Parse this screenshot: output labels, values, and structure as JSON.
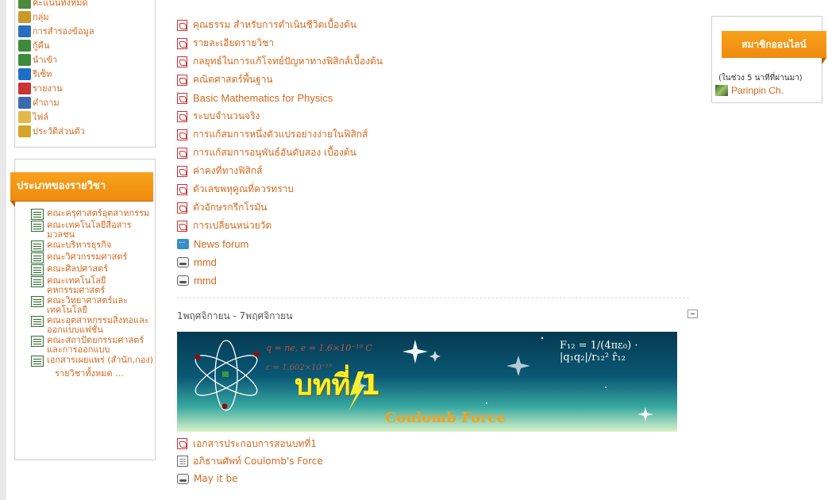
{
  "admin_menu": {
    "items": [
      {
        "label": "คะแนนทั้งหมด",
        "icon": "grades-icon"
      },
      {
        "label": "กลุ่ม",
        "icon": "groups-icon"
      },
      {
        "label": "การสำรองข้อมูล",
        "icon": "backup-icon"
      },
      {
        "label": "กู้คืน",
        "icon": "restore-icon"
      },
      {
        "label": "นำเข้า",
        "icon": "import-icon"
      },
      {
        "label": "รีเซ็ท",
        "icon": "reset-icon"
      },
      {
        "label": "รายงาน",
        "icon": "report-icon"
      },
      {
        "label": "คำถาม",
        "icon": "questions-icon"
      },
      {
        "label": "ไฟล์",
        "icon": "folder-icon"
      },
      {
        "label": "ประวัติส่วนตัว",
        "icon": "profile-icon"
      }
    ]
  },
  "categories": {
    "title": "ประเภทของรายวิชา",
    "items": [
      "คณะครุศาสตร์อุตสาหกรรม",
      "คณะเทคโนโลยีสื่อสารมวลชน",
      "คณะบริหารธุรกิจ",
      "คณะวิศวกรรมศาสตร์",
      "คณะศิลปศาสตร์",
      "คณะเทคโนโลยีคหกรรมศาสตร์",
      "คณะวิทยาศาสตร์และเทคโนโลยี",
      "คณะอุตสาหกรรมสิ่งทอและออกแบบแฟชั่น",
      "คณะสถาปัตยกรรมศาสตร์และการออกแบบ",
      "เอกสารเผยแพร่ (สำนัก,กอง)"
    ],
    "all_courses": "รายวิชาทั้งหมด ..."
  },
  "resources": [
    {
      "label": "คุณธรรม สำหรับการดำเนินชีวิตเบื้องต้น",
      "type": "pdf"
    },
    {
      "label": "รายละเอียดรายวิชา",
      "type": "pdf"
    },
    {
      "label": "กลยุทธ์ในการแก้โจทย์ปัญหาทางฟิสิกส์เบื้องต้น",
      "type": "pdf"
    },
    {
      "label": "คณิตศาสตร์พื้นฐาน",
      "type": "pdf"
    },
    {
      "label": "Basic Mathematics for Physics",
      "type": "pdf"
    },
    {
      "label": "ระบบจำนวนจริง",
      "type": "pdf"
    },
    {
      "label": "การแก้สมการหนึ่งตัวแปรอย่างง่ายในฟิสิกส์",
      "type": "pdf"
    },
    {
      "label": "การแก้สมการอนุพันธ์อันดับสอง เบื้องต้น",
      "type": "pdf"
    },
    {
      "label": "ค่าคงที่ทางฟิสิกส์",
      "type": "pdf"
    },
    {
      "label": "ตัวเลขพหุคูณที่ควรทราบ",
      "type": "pdf"
    },
    {
      "label": "ตัวอักษรกรีกโรมัน",
      "type": "pdf"
    },
    {
      "label": "การเปลี่ยนหน่วยวัด",
      "type": "pdf"
    },
    {
      "label": "News forum",
      "type": "forum"
    },
    {
      "label": "mmd",
      "type": "resource"
    },
    {
      "label": "mmd",
      "type": "resource"
    }
  ],
  "week": {
    "title": "1พฤศจิกายน - 7พฤศจิกายน",
    "banner": {
      "caption": "Coulomb Force",
      "thai_text": "บทที่ 1",
      "formula_left": "q = ne,   e = 1.6×10⁻¹⁹ C",
      "formula_left2": "ε = 1.602×10⁻¹⁹",
      "formula_right": "F₁₂ = 1/(4πε₀) · |q₁q₂|/r₁₂² r̂₁₂"
    },
    "items": [
      {
        "label": "เอกสารประกอบการสอนบทที่1",
        "type": "pdf"
      },
      {
        "label": "อภิธานศัพท์ Coulomb's Force",
        "type": "glossary"
      },
      {
        "label": "May it be",
        "type": "resource"
      }
    ]
  },
  "online_users": {
    "title": "สมาชิกออนไลน์",
    "note": "(ในช่วง 5 นาทีที่ผ่านมา)",
    "users": [
      "Parinpin Ch."
    ]
  }
}
